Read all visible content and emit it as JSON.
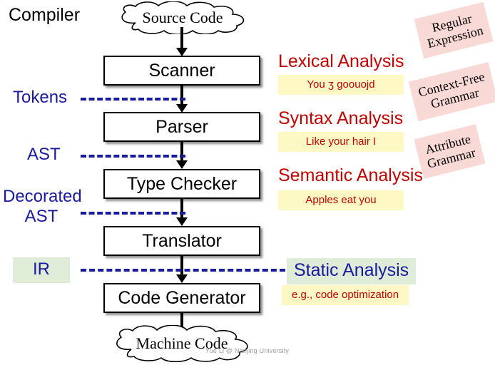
{
  "title": "Compiler",
  "clouds": {
    "input": "Source Code",
    "output": "Machine Code"
  },
  "stages": [
    {
      "label": "Scanner"
    },
    {
      "label": "Parser"
    },
    {
      "label": "Type Checker"
    },
    {
      "label": "Translator"
    },
    {
      "label": "Code Generator"
    }
  ],
  "edge_labels": [
    {
      "label": "Tokens"
    },
    {
      "label": "AST"
    },
    {
      "label": "Decorated\nAST"
    },
    {
      "label": "IR"
    }
  ],
  "edge_labels_flat": {
    "tokens": "Tokens",
    "ast": "AST",
    "decorated_ast_line1": "Decorated",
    "decorated_ast_line2": "AST",
    "ir": "IR"
  },
  "phases": [
    {
      "heading": "Lexical Analysis",
      "note": "You ʒ goouojd"
    },
    {
      "heading": "Syntax Analysis",
      "note": "Like your hair I"
    },
    {
      "heading": "Semantic Analysis",
      "note": "Apples eat you"
    },
    {
      "heading": "Static Analysis",
      "note": "e.g., code optimization"
    }
  ],
  "formalisms": [
    {
      "line1": "Regular",
      "line2": "Expression"
    },
    {
      "line1": "Context-Free",
      "line2": "Grammar"
    },
    {
      "line1": "Attribute",
      "line2": "Grammar"
    }
  ],
  "watermark": "Yue Li @ Nanjing University",
  "colors": {
    "heading_red": "#c00000",
    "label_blue": "#1a1a9e",
    "note_yellow": "#fdf8c4",
    "tag_pink": "#f9d9d6",
    "ir_green": "#dfecd8",
    "box_border": "#000000"
  }
}
